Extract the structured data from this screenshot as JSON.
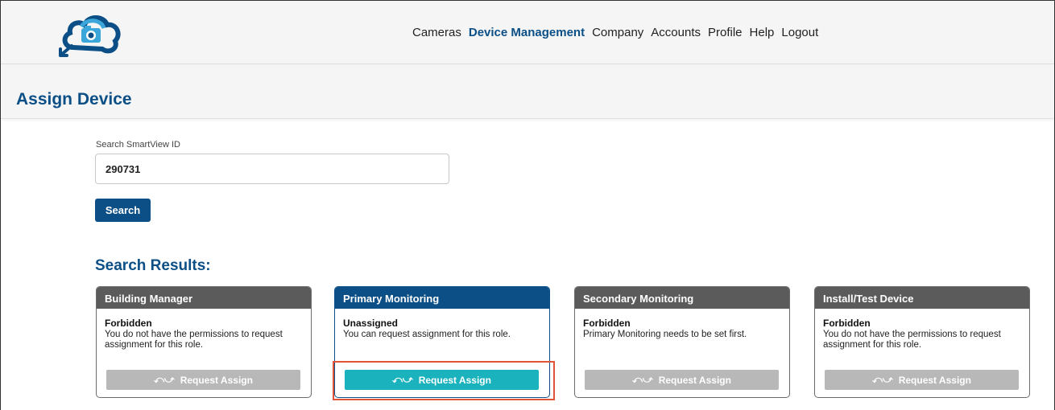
{
  "nav": {
    "items": [
      "Cameras",
      "Device Management",
      "Company",
      "Accounts",
      "Profile",
      "Help",
      "Logout"
    ],
    "active_index": 1
  },
  "page": {
    "title": "Assign Device"
  },
  "search": {
    "label": "Search SmartView ID",
    "value": "290731",
    "button_label": "Search"
  },
  "results": {
    "title": "Search Results:",
    "cards": [
      {
        "role": "Building Manager",
        "status": "Forbidden",
        "description": "You do not have the permissions to request assignment for this role.",
        "button_label": "Request Assign",
        "enabled": false
      },
      {
        "role": "Primary Monitoring",
        "status": "Unassigned",
        "description": "You can request assignment for this role.",
        "button_label": "Request Assign",
        "enabled": true
      },
      {
        "role": "Secondary Monitoring",
        "status": "Forbidden",
        "description": "Primary Monitoring needs to be set first.",
        "button_label": "Request Assign",
        "enabled": false
      },
      {
        "role": "Install/Test Device",
        "status": "Forbidden",
        "description": "You do not have the permissions to request assignment for this role.",
        "button_label": "Request Assign",
        "enabled": false
      }
    ]
  },
  "colors": {
    "brand_blue": "#0b4f86",
    "header_gray": "#5b5b5b",
    "enabled_button": "#1ab2bd",
    "disabled_button": "#b8b8b8",
    "highlight": "#e0553a"
  },
  "icons": {
    "logo": "cloud-camera-logo",
    "swap": "swap-arrows-icon"
  }
}
